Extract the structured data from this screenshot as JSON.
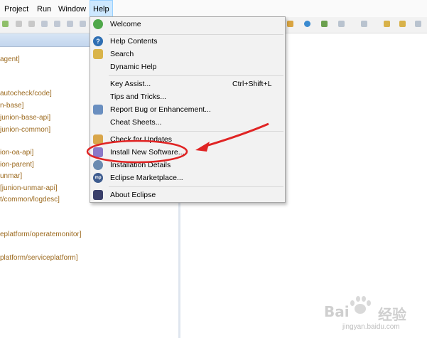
{
  "menubar": {
    "items": [
      "Project",
      "Run",
      "Window",
      "Help"
    ]
  },
  "left_panel": {
    "lines": [
      "agent]",
      "autocheck/code]",
      "n-base]",
      "junion-base-api]",
      "junion-common]",
      "ion-oa-api]",
      "ion-parent]",
      "unmar]",
      "[junion-unmar-api]",
      "t/common/logdesc]",
      "eplatform/operatemonitor]",
      "platform/serviceplatform]"
    ]
  },
  "help_menu": {
    "items": [
      {
        "label": "Welcome",
        "icon": "welcome-icon"
      },
      {
        "label": "Help Contents",
        "icon": "help-contents-icon"
      },
      {
        "label": "Search",
        "icon": "search-icon"
      },
      {
        "label": "Dynamic Help",
        "icon": ""
      },
      {
        "label": "Key Assist...",
        "shortcut": "Ctrl+Shift+L",
        "icon": ""
      },
      {
        "label": "Tips and Tricks...",
        "icon": ""
      },
      {
        "label": "Report Bug or Enhancement...",
        "icon": "bug-report-icon"
      },
      {
        "label": "Cheat Sheets...",
        "icon": ""
      },
      {
        "label": "Check for Updates",
        "icon": "update-icon"
      },
      {
        "label": "Install New Software...",
        "icon": "install-icon"
      },
      {
        "label": "Installation Details",
        "icon": "installation-details-icon"
      },
      {
        "label": "Eclipse Marketplace...",
        "icon": "marketplace-icon"
      },
      {
        "label": "About Eclipse",
        "icon": "eclipse-icon"
      }
    ]
  },
  "watermark": {
    "brand": "Bai",
    "brand_suffix": "经验",
    "url": "jingyan.baidu.com"
  },
  "colors": {
    "menu_background": "#f2f2f2",
    "highlight_help": "#cde8ff",
    "annotation_red": "#e02424",
    "project_text": "#9c6a1f"
  }
}
